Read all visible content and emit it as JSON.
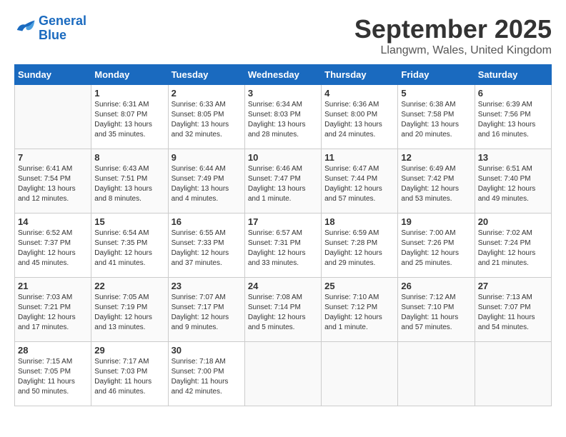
{
  "header": {
    "logo": {
      "line1": "General",
      "line2": "Blue"
    },
    "title": "September 2025",
    "location": "Llangwm, Wales, United Kingdom"
  },
  "weekdays": [
    "Sunday",
    "Monday",
    "Tuesday",
    "Wednesday",
    "Thursday",
    "Friday",
    "Saturday"
  ],
  "weeks": [
    [
      {
        "day": "",
        "sunrise": "",
        "sunset": "",
        "daylight": ""
      },
      {
        "day": "1",
        "sunrise": "Sunrise: 6:31 AM",
        "sunset": "Sunset: 8:07 PM",
        "daylight": "Daylight: 13 hours and 35 minutes."
      },
      {
        "day": "2",
        "sunrise": "Sunrise: 6:33 AM",
        "sunset": "Sunset: 8:05 PM",
        "daylight": "Daylight: 13 hours and 32 minutes."
      },
      {
        "day": "3",
        "sunrise": "Sunrise: 6:34 AM",
        "sunset": "Sunset: 8:03 PM",
        "daylight": "Daylight: 13 hours and 28 minutes."
      },
      {
        "day": "4",
        "sunrise": "Sunrise: 6:36 AM",
        "sunset": "Sunset: 8:00 PM",
        "daylight": "Daylight: 13 hours and 24 minutes."
      },
      {
        "day": "5",
        "sunrise": "Sunrise: 6:38 AM",
        "sunset": "Sunset: 7:58 PM",
        "daylight": "Daylight: 13 hours and 20 minutes."
      },
      {
        "day": "6",
        "sunrise": "Sunrise: 6:39 AM",
        "sunset": "Sunset: 7:56 PM",
        "daylight": "Daylight: 13 hours and 16 minutes."
      }
    ],
    [
      {
        "day": "7",
        "sunrise": "Sunrise: 6:41 AM",
        "sunset": "Sunset: 7:54 PM",
        "daylight": "Daylight: 13 hours and 12 minutes."
      },
      {
        "day": "8",
        "sunrise": "Sunrise: 6:43 AM",
        "sunset": "Sunset: 7:51 PM",
        "daylight": "Daylight: 13 hours and 8 minutes."
      },
      {
        "day": "9",
        "sunrise": "Sunrise: 6:44 AM",
        "sunset": "Sunset: 7:49 PM",
        "daylight": "Daylight: 13 hours and 4 minutes."
      },
      {
        "day": "10",
        "sunrise": "Sunrise: 6:46 AM",
        "sunset": "Sunset: 7:47 PM",
        "daylight": "Daylight: 13 hours and 1 minute."
      },
      {
        "day": "11",
        "sunrise": "Sunrise: 6:47 AM",
        "sunset": "Sunset: 7:44 PM",
        "daylight": "Daylight: 12 hours and 57 minutes."
      },
      {
        "day": "12",
        "sunrise": "Sunrise: 6:49 AM",
        "sunset": "Sunset: 7:42 PM",
        "daylight": "Daylight: 12 hours and 53 minutes."
      },
      {
        "day": "13",
        "sunrise": "Sunrise: 6:51 AM",
        "sunset": "Sunset: 7:40 PM",
        "daylight": "Daylight: 12 hours and 49 minutes."
      }
    ],
    [
      {
        "day": "14",
        "sunrise": "Sunrise: 6:52 AM",
        "sunset": "Sunset: 7:37 PM",
        "daylight": "Daylight: 12 hours and 45 minutes."
      },
      {
        "day": "15",
        "sunrise": "Sunrise: 6:54 AM",
        "sunset": "Sunset: 7:35 PM",
        "daylight": "Daylight: 12 hours and 41 minutes."
      },
      {
        "day": "16",
        "sunrise": "Sunrise: 6:55 AM",
        "sunset": "Sunset: 7:33 PM",
        "daylight": "Daylight: 12 hours and 37 minutes."
      },
      {
        "day": "17",
        "sunrise": "Sunrise: 6:57 AM",
        "sunset": "Sunset: 7:31 PM",
        "daylight": "Daylight: 12 hours and 33 minutes."
      },
      {
        "day": "18",
        "sunrise": "Sunrise: 6:59 AM",
        "sunset": "Sunset: 7:28 PM",
        "daylight": "Daylight: 12 hours and 29 minutes."
      },
      {
        "day": "19",
        "sunrise": "Sunrise: 7:00 AM",
        "sunset": "Sunset: 7:26 PM",
        "daylight": "Daylight: 12 hours and 25 minutes."
      },
      {
        "day": "20",
        "sunrise": "Sunrise: 7:02 AM",
        "sunset": "Sunset: 7:24 PM",
        "daylight": "Daylight: 12 hours and 21 minutes."
      }
    ],
    [
      {
        "day": "21",
        "sunrise": "Sunrise: 7:03 AM",
        "sunset": "Sunset: 7:21 PM",
        "daylight": "Daylight: 12 hours and 17 minutes."
      },
      {
        "day": "22",
        "sunrise": "Sunrise: 7:05 AM",
        "sunset": "Sunset: 7:19 PM",
        "daylight": "Daylight: 12 hours and 13 minutes."
      },
      {
        "day": "23",
        "sunrise": "Sunrise: 7:07 AM",
        "sunset": "Sunset: 7:17 PM",
        "daylight": "Daylight: 12 hours and 9 minutes."
      },
      {
        "day": "24",
        "sunrise": "Sunrise: 7:08 AM",
        "sunset": "Sunset: 7:14 PM",
        "daylight": "Daylight: 12 hours and 5 minutes."
      },
      {
        "day": "25",
        "sunrise": "Sunrise: 7:10 AM",
        "sunset": "Sunset: 7:12 PM",
        "daylight": "Daylight: 12 hours and 1 minute."
      },
      {
        "day": "26",
        "sunrise": "Sunrise: 7:12 AM",
        "sunset": "Sunset: 7:10 PM",
        "daylight": "Daylight: 11 hours and 57 minutes."
      },
      {
        "day": "27",
        "sunrise": "Sunrise: 7:13 AM",
        "sunset": "Sunset: 7:07 PM",
        "daylight": "Daylight: 11 hours and 54 minutes."
      }
    ],
    [
      {
        "day": "28",
        "sunrise": "Sunrise: 7:15 AM",
        "sunset": "Sunset: 7:05 PM",
        "daylight": "Daylight: 11 hours and 50 minutes."
      },
      {
        "day": "29",
        "sunrise": "Sunrise: 7:17 AM",
        "sunset": "Sunset: 7:03 PM",
        "daylight": "Daylight: 11 hours and 46 minutes."
      },
      {
        "day": "30",
        "sunrise": "Sunrise: 7:18 AM",
        "sunset": "Sunset: 7:00 PM",
        "daylight": "Daylight: 11 hours and 42 minutes."
      },
      {
        "day": "",
        "sunrise": "",
        "sunset": "",
        "daylight": ""
      },
      {
        "day": "",
        "sunrise": "",
        "sunset": "",
        "daylight": ""
      },
      {
        "day": "",
        "sunrise": "",
        "sunset": "",
        "daylight": ""
      },
      {
        "day": "",
        "sunrise": "",
        "sunset": "",
        "daylight": ""
      }
    ]
  ]
}
